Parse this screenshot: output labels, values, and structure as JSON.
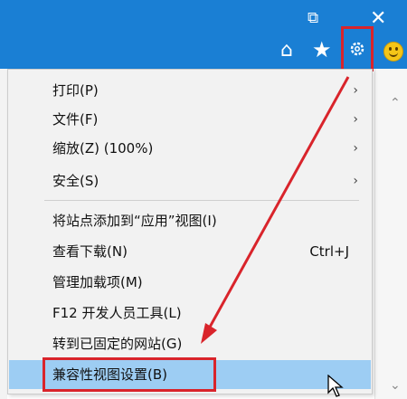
{
  "window": {
    "restore_icon": "restore-icon",
    "close_icon": "close-icon"
  },
  "commandbar": {
    "home_icon": "home-icon",
    "favorites_icon": "star-icon",
    "tools_icon": "gear-icon",
    "feedback_icon": "smiley-icon"
  },
  "menu": {
    "items": [
      {
        "label": "打印(P)",
        "submenu": true
      },
      {
        "label": "文件(F)",
        "submenu": true
      },
      {
        "label": "缩放(Z) (100%)",
        "submenu": true
      },
      {
        "label": "安全(S)",
        "submenu": true
      },
      {
        "label": "将站点添加到“应用”视图(I)"
      },
      {
        "label": "查看下载(N)",
        "shortcut": "Ctrl+J"
      },
      {
        "label": "管理加载项(M)"
      },
      {
        "label": "F12 开发人员工具(L)"
      },
      {
        "label": "转到已固定的网站(G)"
      },
      {
        "label": "兼容性视图设置(B)",
        "highlighted": true
      }
    ],
    "arrow_glyph": "›"
  },
  "annotation": {
    "color": "#d9242b"
  },
  "colors": {
    "titlebar": "#1a7fd4",
    "highlight": "#9dcdf3",
    "menu_bg": "#f2f2f2"
  }
}
